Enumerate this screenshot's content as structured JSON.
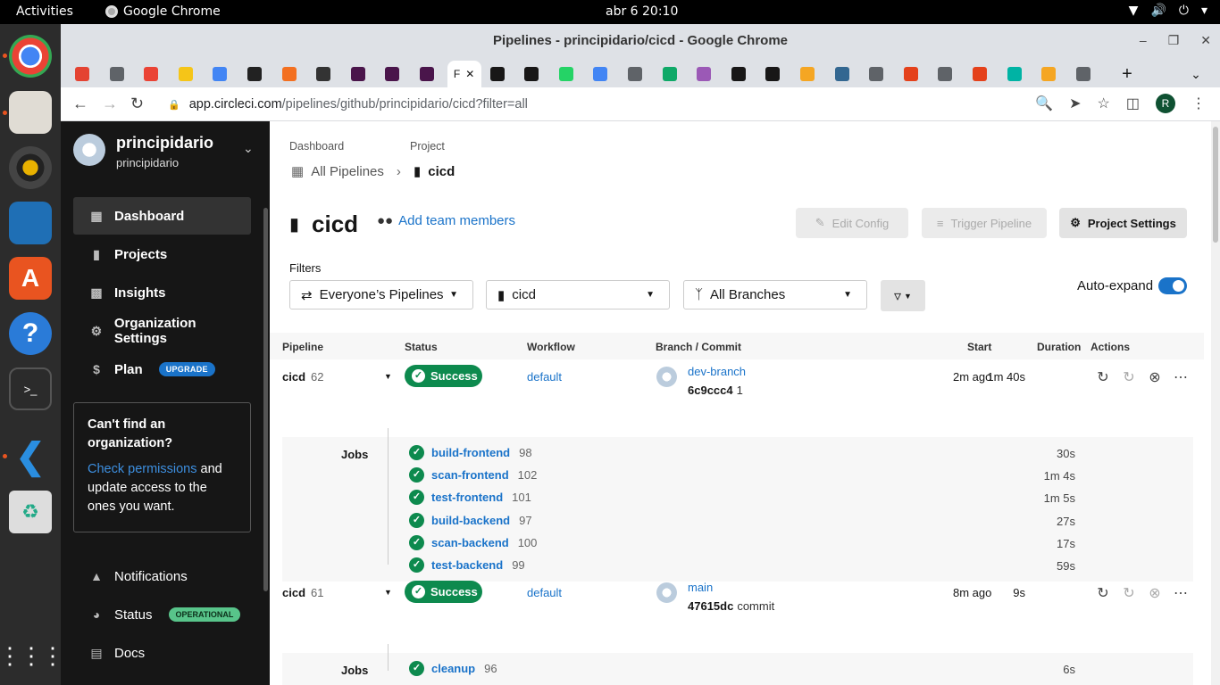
{
  "topbar": {
    "activities": "Activities",
    "app": "Google Chrome",
    "clock": "abr 6  20:10"
  },
  "dock": [
    "chrome-icon",
    "files-icon",
    "rhythmbox-icon",
    "writer-icon",
    "software-center-icon",
    "help-icon",
    "terminal-icon",
    "vscode-icon",
    "trash-icon",
    "apps-grid-icon"
  ],
  "window": {
    "title": "Pipelines - principidario/cicd - Google Chrome"
  },
  "tabs": {
    "active_label": "F",
    "favicon_colors": [
      "#e44332",
      "#5f6368",
      "#ea4335",
      "#f5c518",
      "#4285f4",
      "#222222",
      "#f37021",
      "#333333",
      "#4a154b",
      "#4a154b",
      "#4a154b",
      "#1a1a1a",
      "#181717",
      "#181717",
      "#25d366",
      "#4285f4",
      "#5f6368",
      "#0fa968",
      "#9b59b6",
      "#181717",
      "#181717",
      "#f5a623",
      "#336791",
      "#5f6368",
      "#e4411b",
      "#5f6368",
      "#e4411b",
      "#00b3a4",
      "#f5a623",
      "#5f6368"
    ]
  },
  "address": {
    "host": "app.circleci.com",
    "path": "/pipelines/github/principidario/cicd?filter=all",
    "profile": "R"
  },
  "sidebar": {
    "org_name": "principidario",
    "org_sub": "principidario",
    "nav": [
      {
        "label": "Dashboard",
        "icon": "dashboard-icon"
      },
      {
        "label": "Projects",
        "icon": "projects-icon"
      },
      {
        "label": "Insights",
        "icon": "insights-icon"
      },
      {
        "label": "Organization Settings",
        "icon": "gear-icon"
      },
      {
        "label": "Plan",
        "icon": "dollar-icon",
        "badge": "UPGRADE"
      }
    ],
    "cta": {
      "title": "Can't find an organization?",
      "link": "Check permissions",
      "rest": " and update access to the ones you want."
    },
    "bottom": [
      {
        "label": "Notifications",
        "icon": "bell-icon"
      },
      {
        "label": "Status",
        "icon": "status-icon",
        "badge": "OPERATIONAL"
      },
      {
        "label": "Docs",
        "icon": "docs-icon"
      }
    ]
  },
  "breadcrumb": {
    "dashboard_label": "Dashboard",
    "dashboard_value": "All Pipelines",
    "project_label": "Project",
    "project_value": "cicd"
  },
  "header": {
    "title": "cicd",
    "add_team": "Add team members",
    "edit_config": "Edit Config",
    "trigger": "Trigger Pipeline",
    "settings": "Project Settings"
  },
  "filters": {
    "label": "Filters",
    "pipelines": "Everyone’s Pipelines",
    "project": "cicd",
    "branches": "All Branches",
    "autoexpand": "Auto-expand",
    "autoexpand_on": true
  },
  "table": {
    "headers": [
      "Pipeline",
      "Status",
      "Workflow",
      "Branch / Commit",
      "Start",
      "Duration",
      "Actions"
    ],
    "jobs_label": "Jobs",
    "pipelines": [
      {
        "name": "cicd",
        "number": "62",
        "status": "Success",
        "workflow": "default",
        "branch": "dev-branch",
        "commit": "6c9ccc4",
        "commit_msg": "1",
        "start": "2m ago",
        "duration": "1m 40s",
        "jobs": [
          {
            "name": "build-frontend",
            "num": "98",
            "dur": "30s"
          },
          {
            "name": "scan-frontend",
            "num": "102",
            "dur": "1m 4s"
          },
          {
            "name": "test-frontend",
            "num": "101",
            "dur": "1m 5s"
          },
          {
            "name": "build-backend",
            "num": "97",
            "dur": "27s"
          },
          {
            "name": "scan-backend",
            "num": "100",
            "dur": "17s"
          },
          {
            "name": "test-backend",
            "num": "99",
            "dur": "59s"
          }
        ]
      },
      {
        "name": "cicd",
        "number": "61",
        "status": "Success",
        "workflow": "default",
        "branch": "main",
        "commit": "47615dc",
        "commit_msg": "commit",
        "start": "8m ago",
        "duration": "9s",
        "jobs": [
          {
            "name": "cleanup",
            "num": "96",
            "dur": "6s"
          }
        ]
      }
    ]
  },
  "colors": {
    "sidebar_bg": "#161616",
    "link": "#1a73c9",
    "success": "#0d8a4e"
  }
}
